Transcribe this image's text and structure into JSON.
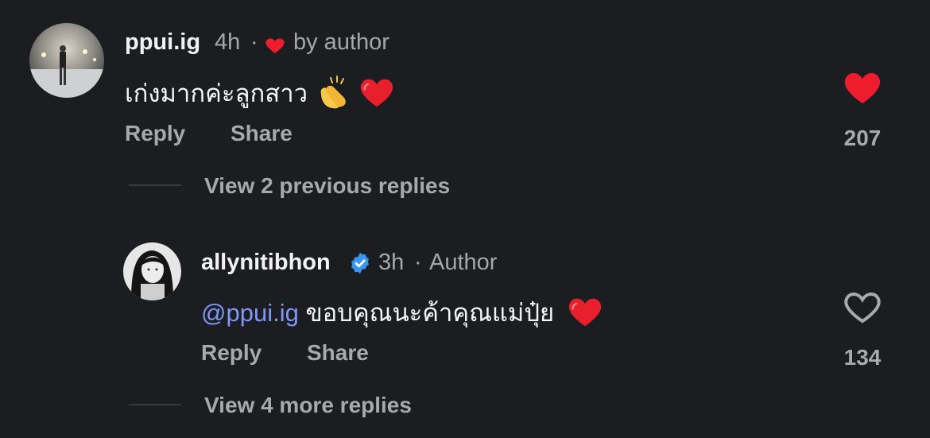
{
  "comments": [
    {
      "username": "ppui.ig",
      "time": "4h",
      "separator": "·",
      "badge_text": "by author",
      "text": "เก่งมากค่ะลูกสาว",
      "like_count": "207",
      "reply_label": "Reply",
      "share_label": "Share",
      "liked": true
    },
    {
      "username": "allynitibhon",
      "verified": true,
      "time": "3h",
      "separator": "·",
      "role": "Author",
      "mention": "@ppui.ig",
      "text": "ขอบคุณนะค้าคุณแม่ปุ๋ย",
      "like_count": "134",
      "reply_label": "Reply",
      "share_label": "Share",
      "liked": false
    }
  ],
  "view_previous": "View 2 previous replies",
  "view_more": "View 4 more replies",
  "colors": {
    "background": "#1c1d21",
    "heart_red": "#ee1d2e",
    "verified_blue": "#3897f0",
    "mention": "#7f97f5",
    "muted": "#a8a9ad"
  },
  "icons": [
    "heart-icon",
    "clapping-hands-emoji",
    "red-heart-emoji",
    "verified-badge-icon",
    "heart-outline-icon"
  ]
}
